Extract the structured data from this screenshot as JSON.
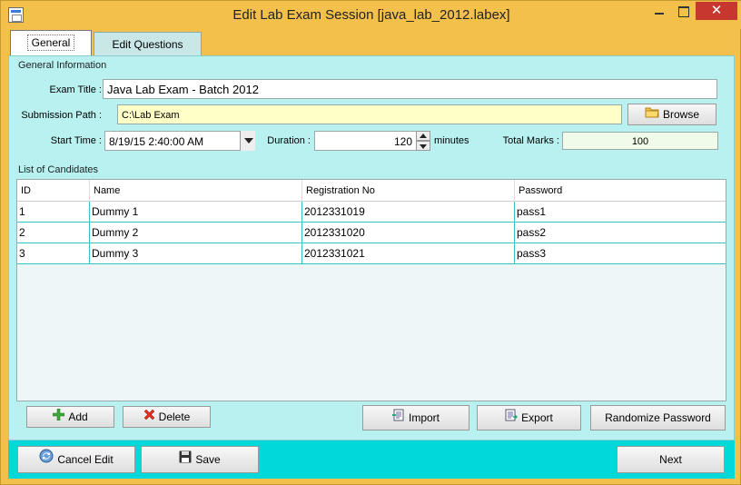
{
  "window": {
    "title": "Edit Lab Exam Session [java_lab_2012.labex]",
    "close_glyph": "✕"
  },
  "tabs": [
    {
      "label": "General",
      "selected": true
    },
    {
      "label": "Edit Questions",
      "selected": false
    }
  ],
  "general": {
    "section_label": "General Information",
    "exam_title_label": "Exam Title :",
    "exam_title_value": "Java Lab Exam - Batch 2012",
    "submission_path_label": "Submission Path :",
    "submission_path_value": "C:\\Lab Exam",
    "browse_label": "Browse",
    "start_time_label": "Start Time :",
    "start_time_value": "8/19/15 2:40:00 AM",
    "duration_label": "Duration :",
    "duration_value": "120",
    "duration_unit": "minutes",
    "total_marks_label": "Total Marks :",
    "total_marks_value": "100"
  },
  "candidates": {
    "section_label": "List of Candidates",
    "columns": [
      "ID",
      "Name",
      "Registration No",
      "Password"
    ],
    "rows": [
      [
        "1",
        "Dummy 1",
        "2012331019",
        "pass1"
      ],
      [
        "2",
        "Dummy 2",
        "2012331020",
        "pass2"
      ],
      [
        "3",
        "Dummy 3",
        "2012331021",
        "pass3"
      ]
    ],
    "add_label": "Add",
    "delete_label": "Delete",
    "import_label": "Import",
    "export_label": "Export",
    "randomize_label": "Randomize Password"
  },
  "footer": {
    "cancel_label": "Cancel Edit",
    "save_label": "Save",
    "next_label": "Next"
  },
  "colors": {
    "title_bar": "#f3c04b",
    "panel": "#b9f1f1",
    "bottom_bar": "#00d8da",
    "close_button": "#c7372f"
  }
}
